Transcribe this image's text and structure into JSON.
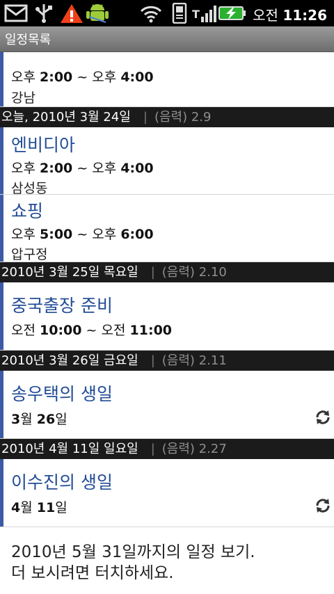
{
  "status_bar": {
    "time_prefix": "오전",
    "time": "11:26",
    "icons": [
      "sms-icon",
      "usb-icon",
      "warning-icon",
      "android-debug-icon",
      "wifi-icon",
      "phone-icon",
      "signal-icon",
      "battery-charging-icon"
    ]
  },
  "app": {
    "title": "일정목록"
  },
  "first_event": {
    "time_start_prefix": "오후",
    "time_start": "2:00",
    "tilde": "~",
    "time_end_prefix": "오후",
    "time_end": "4:00",
    "location": "강남"
  },
  "groups": [
    {
      "date": "오늘, 2010년 3월 24일",
      "lunar_label": "(음력)",
      "lunar": "2.9",
      "events": [
        {
          "title": "엔비디아",
          "start_prefix": "오후",
          "start": "2:00",
          "end_prefix": "오후",
          "end": "4:00",
          "location": "삼성동"
        },
        {
          "title": "쇼핑",
          "start_prefix": "오후",
          "start": "5:00",
          "end_prefix": "오후",
          "end": "6:00",
          "location": "압구정"
        }
      ]
    },
    {
      "date": "2010년 3월 25일 목요일",
      "lunar_label": "(음력)",
      "lunar": "2.10",
      "events": [
        {
          "title": "중국출장 준비",
          "start_prefix": "오전",
          "start": "10:00",
          "end_prefix": "오전",
          "end": "11:00"
        }
      ]
    },
    {
      "date": "2010년 3월 26일 금요일",
      "lunar_label": "(음력)",
      "lunar": "2.11",
      "events": [
        {
          "title": "송우택의 생일",
          "month": "3",
          "month_unit": "월",
          "day": "26",
          "day_unit": "일"
        }
      ]
    },
    {
      "date": "2010년 4월 11일 일요일",
      "lunar_label": "(음력)",
      "lunar": "2.27",
      "events": [
        {
          "title": "이수진의 생일",
          "month": "4",
          "month_unit": "월",
          "day": "11",
          "day_unit": "일"
        }
      ]
    }
  ],
  "separator": "|",
  "footer": {
    "line1": "2010년 5월 31일까지의 일정 보기.",
    "line2": "더 보시려면 터치하세요."
  },
  "colors": {
    "accent_bar": "#3c5aa5",
    "title_text": "#224c96",
    "header_bg": "#1b1b1b"
  }
}
